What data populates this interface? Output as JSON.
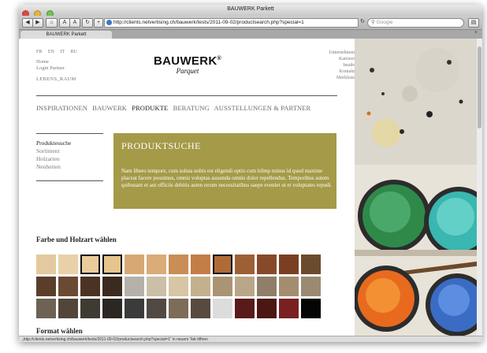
{
  "window": {
    "title": "BAUWERK Parkett"
  },
  "toolbar": {
    "url": "http://clients.netvertising.ch/bauwerk/tests/2011-09-02/productsearch.php?special=1",
    "search_placeholder": "Google",
    "back_icon": "back-arrow-icon",
    "forward_icon": "forward-arrow-icon",
    "home_icon": "home-icon",
    "font_smaller": "A",
    "font_larger": "A",
    "reload_icon": "reload-icon",
    "add_icon": "plus-icon",
    "print_icon": "print-icon"
  },
  "tab": {
    "label": "BAUWERK Parkett"
  },
  "site": {
    "languages": [
      "FR",
      "EN",
      "IT",
      "RU"
    ],
    "left_menu": [
      "Home",
      "Login Partner"
    ],
    "lebensraum": "LEBENS_RAUM",
    "logo_main": "BAUWERK",
    "logo_reg": "®",
    "logo_sub": "Parquet",
    "right_menu": [
      "Unternehmen",
      "Karriere",
      "Inside",
      "Kontakt",
      "Merkliste"
    ],
    "main_nav": [
      {
        "label": "INSPIRATIONEN",
        "active": false
      },
      {
        "label": "BAUWERK",
        "active": false
      },
      {
        "label": "PRODUKTE",
        "active": true
      },
      {
        "label": "BERATUNG",
        "active": false
      },
      {
        "label": "AUSSTELLUNGEN & PARTNER",
        "active": false
      }
    ],
    "sub_nav": [
      {
        "label": "Produktesuche",
        "active": true
      },
      {
        "label": "Sortiment",
        "active": false
      },
      {
        "label": "Holzarten",
        "active": false
      },
      {
        "label": "Neuheiten",
        "active": false
      }
    ],
    "box_title": "PRODUKTSUCHE",
    "box_text": "Nam libero tempore, cum soluta nobis est eligendi optio cum hilmp minus id quod maxime placeat facere possimus, omnis voluptas assumda omnis dolor repellendus. Temporibus autem quibusam et aut officiis debitis auten rerum necessitatibus saepe eveniet ut et voluptates repudi.",
    "section_color": "Farbe und Holzart wählen",
    "section_format": "Format wählen",
    "hero_arrow": "‹",
    "hero_image": "paint-palette-image",
    "swatches": [
      [
        "#e3c99f",
        "#e8d1a8",
        "#e9cc9a",
        "#e6c48e",
        "#d7a873",
        "#d9ac78",
        "#c98d55",
        "#c47d47",
        "#b06a38",
        "#9e5f35",
        "#86492a",
        "#7a3f22",
        "#6a4b2e"
      ],
      [
        "#5a3e2a",
        "#6b4a33",
        "#4b3324",
        "#3b2a1f",
        "#b5b1aa",
        "#cbbfa8",
        "#d6c6a6",
        "#c5b08e",
        "#a99474",
        "#b9a689",
        "#8f7e69",
        "#a48d6f",
        "#9b8a72"
      ],
      [
        "#6d6253",
        "#514639",
        "#3f3a32",
        "#2b2723",
        "#3b3b3b",
        "#514a42",
        "#7d6c58",
        "#574a40",
        "#dcdcdc",
        "#5b1a1a",
        "#4a1712",
        "#7a2020",
        "#050505"
      ]
    ],
    "swatch_selected": [
      [
        2,
        3,
        8
      ]
    ]
  },
  "status": {
    "text": "„http://clients.netvertising.ch/bauwerk/tests/2011-09-02/productsearch.php?special=1“ in neuem Tab öffnen"
  }
}
